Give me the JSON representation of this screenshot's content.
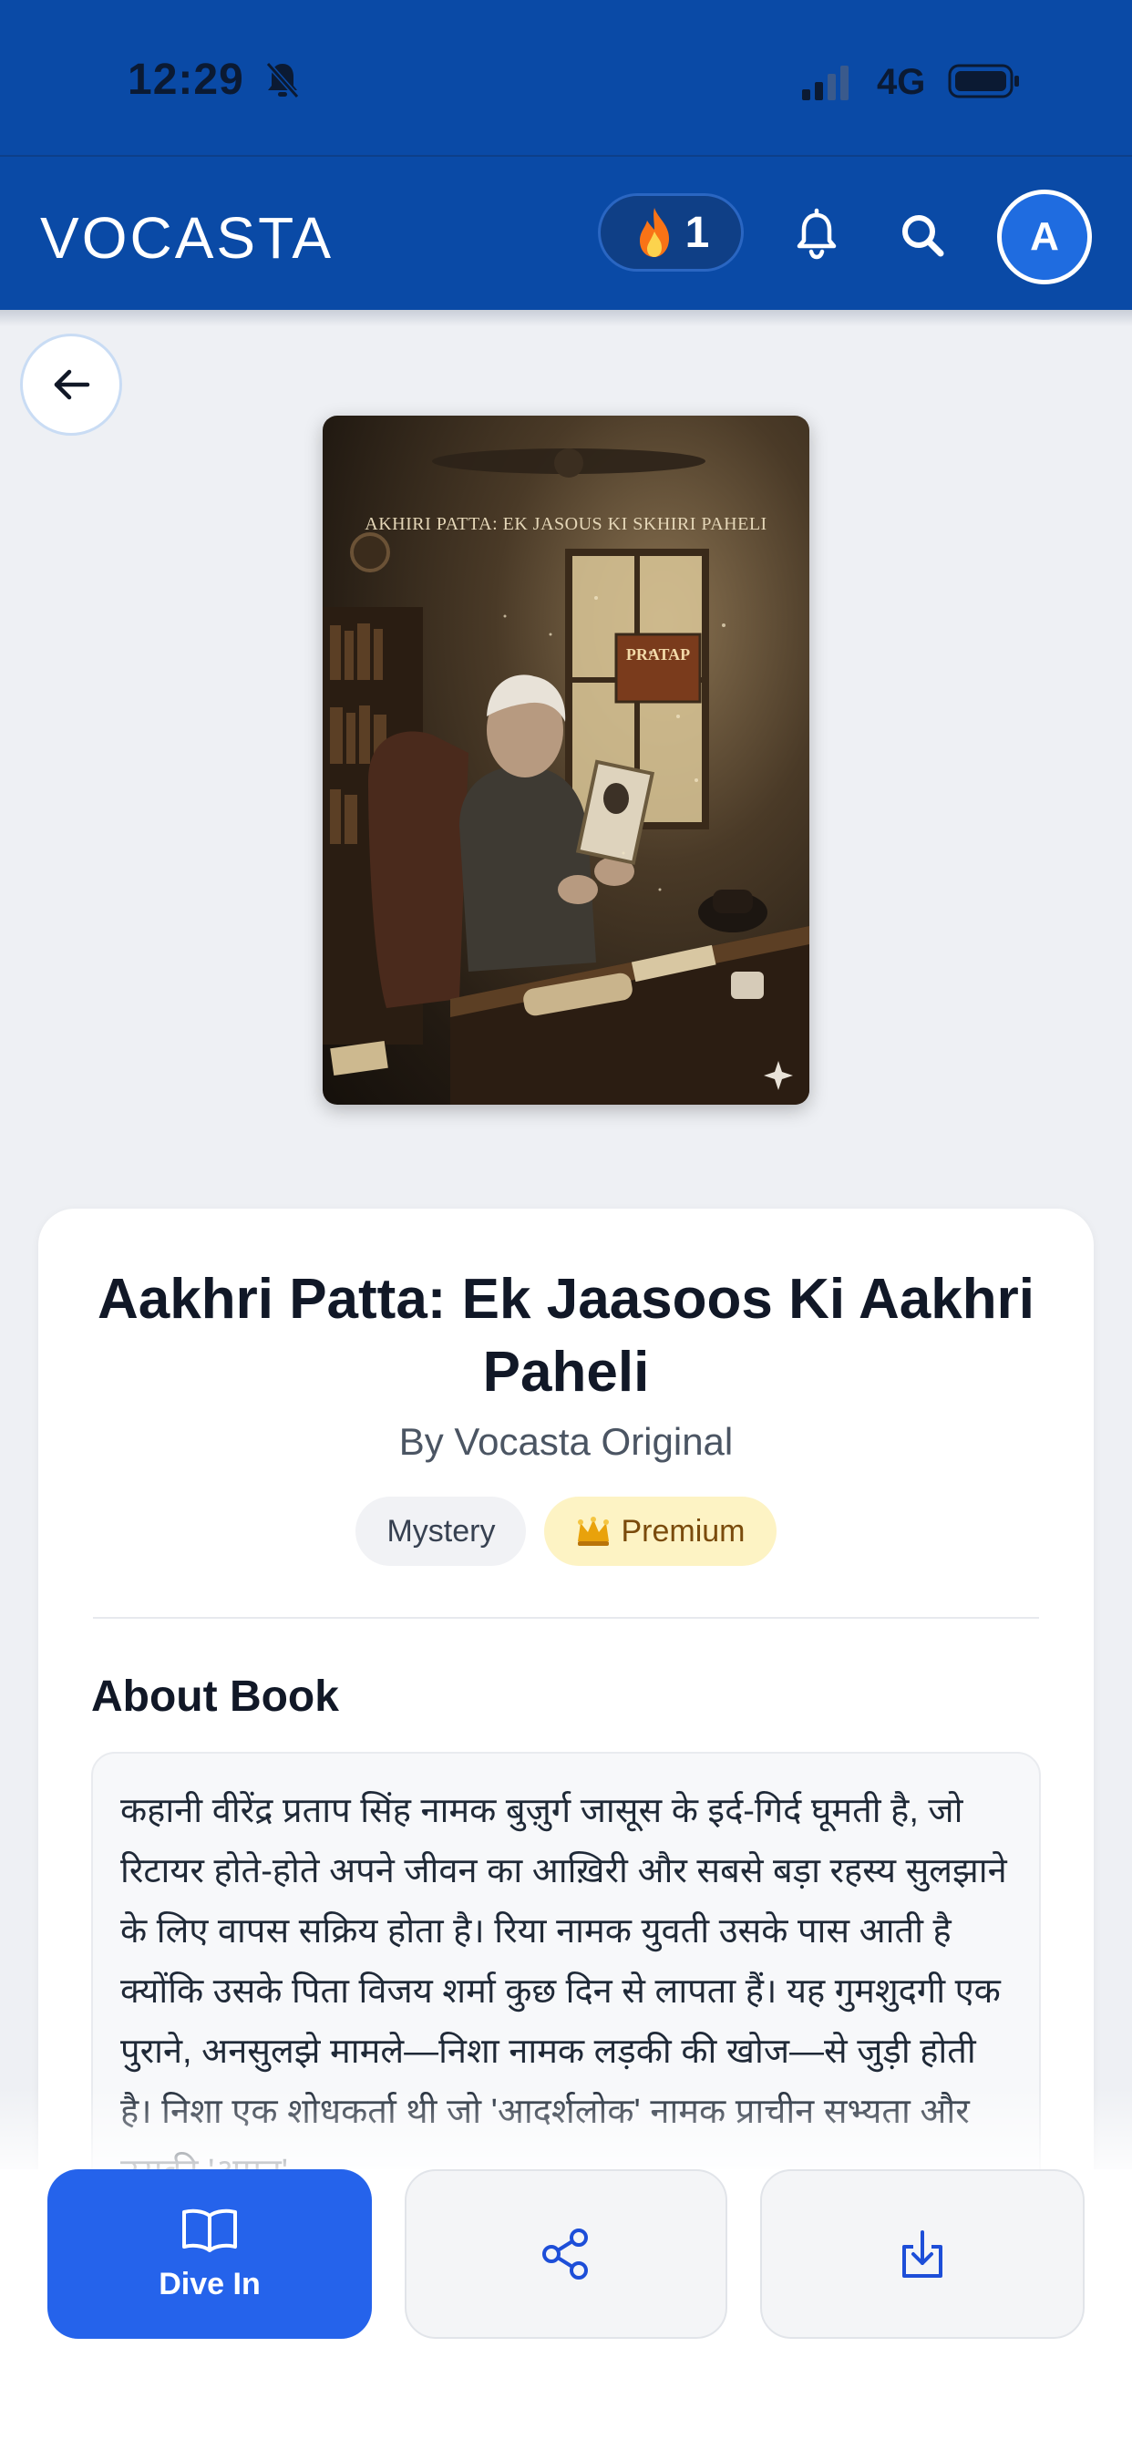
{
  "status_bar": {
    "time": "12:29",
    "network": "4G"
  },
  "header": {
    "brand": "VOCASTA",
    "streak_count": "1",
    "avatar_initial": "A"
  },
  "book": {
    "cover_title": "AKHIRI PATTA: EK JASOUS KI SKHIRI PAHELI",
    "cover_sign": "PRATAP",
    "title": "Aakhri Patta: Ek Jaasoos Ki Aakhri Paheli",
    "author": "By Vocasta Original",
    "tags": {
      "genre": "Mystery",
      "premium": "Premium"
    }
  },
  "about": {
    "heading": "About Book",
    "text": "कहानी वीरेंद्र प्रताप सिंह नामक बुज़ुर्ग जासूस के इर्द-गिर्द घूमती है, जो रिटायर होते-होते अपने जीवन का आख़िरी और सबसे बड़ा रहस्य सुलझाने के लिए वापस सक्रिय होता है। रिया नामक युवती उसके पास आती है क्योंकि उसके पिता विजय शर्मा कुछ दिन से लापता हैं। यह गुमशुदगी एक पुराने, अनसुलझे मामले—निशा नामक लड़की की खोज—से जुड़ी होती है। निशा एक शोधकर्ता थी जो 'आदर्शलोक' नामक प्राचीन सभ्यता और उसकी 'अमृत'"
  },
  "actions": {
    "primary_label": "Dive In"
  },
  "icons": {
    "muted": "bell-slash-icon",
    "streak": "flame-icon",
    "notifications": "bell-icon",
    "search": "search-icon",
    "back": "arrow-left-icon",
    "read": "open-book-icon",
    "share": "share-icon",
    "download": "download-icon",
    "premium": "crown-icon"
  },
  "colors": {
    "header_bg": "#0a4aa6",
    "primary_button": "#2563eb",
    "premium_tag_bg": "#fdf3c4",
    "premium_tag_text": "#7a4b0c"
  }
}
